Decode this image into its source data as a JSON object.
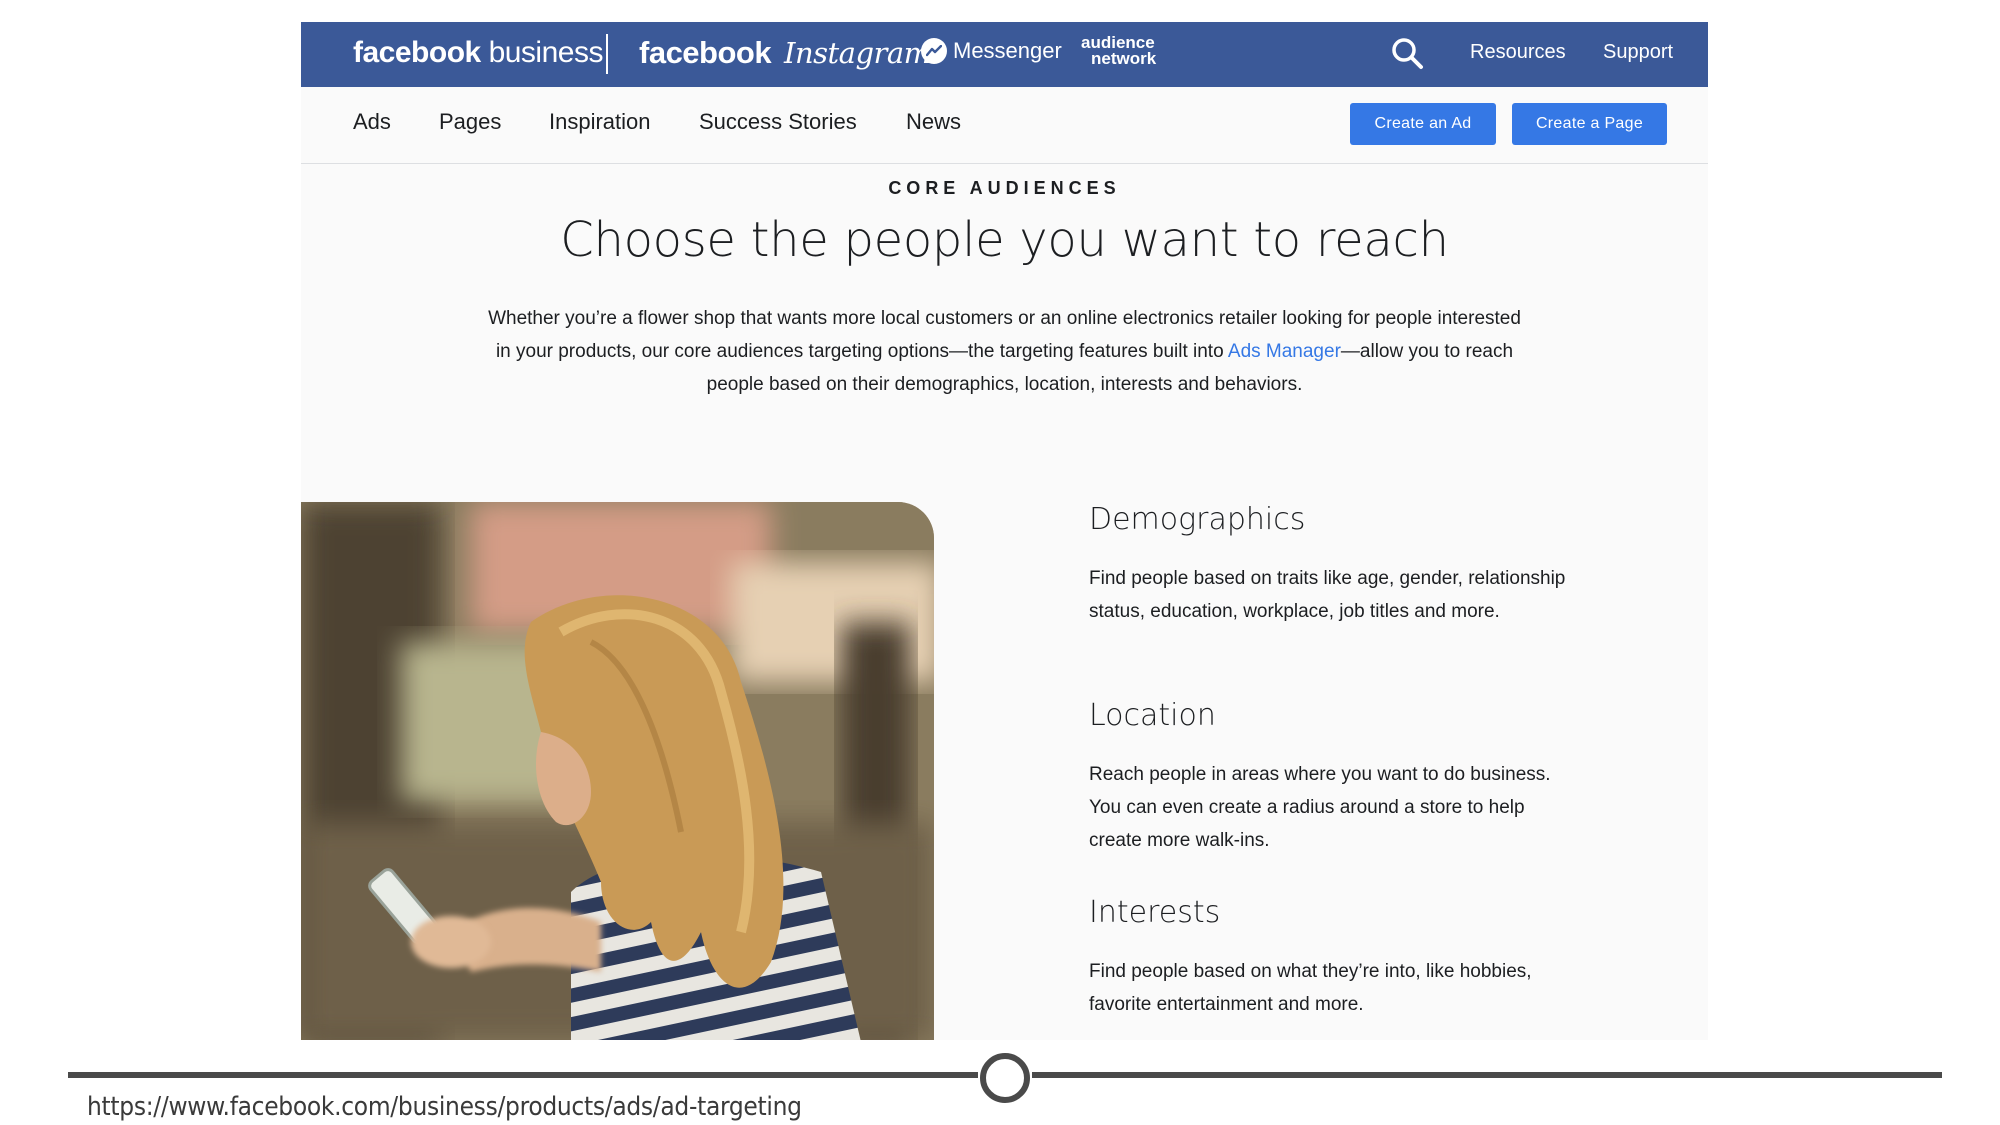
{
  "topbar": {
    "brand_primary": "facebook",
    "brand_secondary": "business",
    "brand_facebook": "facebook",
    "brand_instagram": "Instagram",
    "brand_messenger": "Messenger",
    "brand_audience_line1": "audience",
    "brand_audience_line2": "network",
    "links": [
      "Resources",
      "Support"
    ],
    "background": "#3b5998"
  },
  "subnav": {
    "items": [
      "Ads",
      "Pages",
      "Inspiration",
      "Success Stories",
      "News"
    ],
    "cta_primary": "Create an Ad",
    "cta_secondary": "Create a Page",
    "cta_color": "#3578e5"
  },
  "hero": {
    "eyebrow": "CORE AUDIENCES",
    "headline": "Choose the people you want to reach",
    "intro_before": "Whether you’re a flower shop that wants more local customers or an online electronics retailer looking for people interested in your products, our core audiences targeting options—the targeting features built into ",
    "intro_link": "Ads Manager",
    "intro_after": "—allow you to reach people based on their demographics, location, interests and behaviors."
  },
  "features": [
    {
      "title": "Demographics",
      "body": "Find people based on traits like age, gender, relationship status, education, workplace, job titles and more."
    },
    {
      "title": "Location",
      "body": "Reach people in areas where you want to do business. You can even create a radius around a store to help create more walk-ins."
    },
    {
      "title": "Interests",
      "body": "Find people based on what they’re into, like hobbies, favorite entertainment and more."
    }
  ],
  "caption": {
    "url": "https://www.facebook.com/business/products/ads/ad-targeting"
  }
}
